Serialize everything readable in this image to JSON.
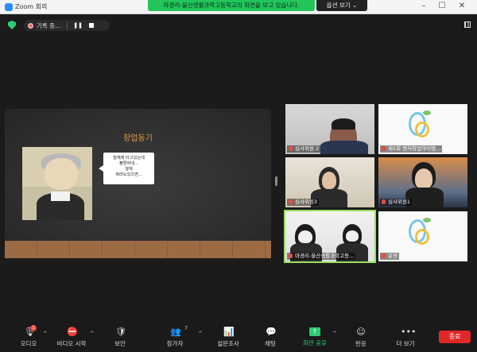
{
  "window": {
    "app_title": "Zoom 회의",
    "share_banner": "마경리-울산생활과학고등학교의 화면을 보고 있습니다.",
    "view_options": "옵션 보기 ⌄"
  },
  "recording": {
    "label": "기록 중..."
  },
  "grid_view": {
    "label": ""
  },
  "slide": {
    "title": "창업동기",
    "speech_lines": [
      "할께에 타고있는데",
      "불편하네...",
      "앞에",
      "뭐라도있으면..."
    ]
  },
  "tiles": [
    {
      "name": "심사위원 2"
    },
    {
      "name": "제5회 벤처창업아이템..."
    },
    {
      "name": "심사위원3"
    },
    {
      "name": "심사위원1"
    },
    {
      "name": "마경리-울산생활과학고등..."
    },
    {
      "name": "운영"
    }
  ],
  "toolbar": {
    "audio": "오디오",
    "audio_badge": "1",
    "video": "비디오 시작",
    "security": "보안",
    "participants": "참가자",
    "participants_count": "7",
    "polls": "설문조사",
    "chat": "채팅",
    "share": "화면 공유",
    "reactions": "반응",
    "more": "더 보기",
    "end": "종료"
  },
  "colors": {
    "share_banner_bg": "#23c45a",
    "slide_title": "#e39a3c",
    "active_speaker_outline": "#9be060",
    "end_button": "#e02828"
  }
}
